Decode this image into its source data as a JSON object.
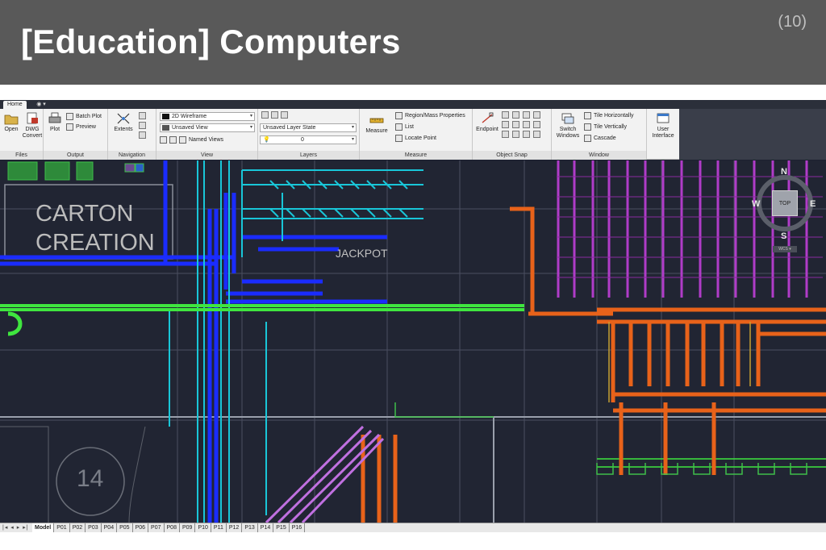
{
  "slide": {
    "title": "[Education] Computers",
    "number": "(10)"
  },
  "ribbon": {
    "tab_home": "Home",
    "tab_extra": "◉ ▾",
    "panels": {
      "files": {
        "title": "Files",
        "open": "Open",
        "dwg_convert": "DWG Convert"
      },
      "output": {
        "title": "Output",
        "plot": "Plot",
        "batch_plot": "Batch Plot",
        "preview": "Preview"
      },
      "navigation": {
        "title": "Navigation",
        "extents": "Extents"
      },
      "view": {
        "title": "View",
        "visual_style": "2D Wireframe",
        "saved_view": "Unsaved View",
        "named_views": "Named Views"
      },
      "layers": {
        "title": "Layers",
        "layer_state": "Unsaved Layer State",
        "current_layer": "0"
      },
      "measure": {
        "title": "Measure",
        "measure": "Measure",
        "region_mass": "Region/Mass Properties",
        "list": "List",
        "locate_point": "Locate Point"
      },
      "object_snap": {
        "title": "Object Snap",
        "endpoint": "Endpoint"
      },
      "window": {
        "title": "Window",
        "switch_windows": "Switch Windows",
        "tile_horizontally": "Tile Horizontally",
        "tile_vertically": "Tile Vertically",
        "cascade": "Cascade",
        "user_interface": "User Interface"
      }
    }
  },
  "drawing": {
    "label_carton_line1": "CARTON",
    "label_carton_line2": "CREATION",
    "label_jackpot": "JACKPOT",
    "label_fourteen": "14",
    "viewcube": {
      "n": "N",
      "s": "S",
      "e": "E",
      "w": "W",
      "face": "TOP",
      "wcs": "WCS ▾"
    }
  },
  "layout_tabs": {
    "nav": "|◂ ◂ ▸ ▸|",
    "tabs": [
      "Model",
      "P01",
      "P02",
      "P03",
      "P04",
      "P05",
      "P06",
      "P07",
      "P08",
      "P09",
      "P10",
      "P11",
      "P12",
      "P13",
      "P14",
      "P15",
      "P16"
    ],
    "active": "Model"
  },
  "colors": {
    "header_bg": "#595959",
    "drawing_bg": "#212533",
    "conveyor_blue": "#1a2cff",
    "conveyor_cyan": "#19c6d8",
    "conveyor_green": "#3fe63f",
    "conveyor_orange": "#e8621a",
    "rack_magenta": "#b03cc8"
  }
}
